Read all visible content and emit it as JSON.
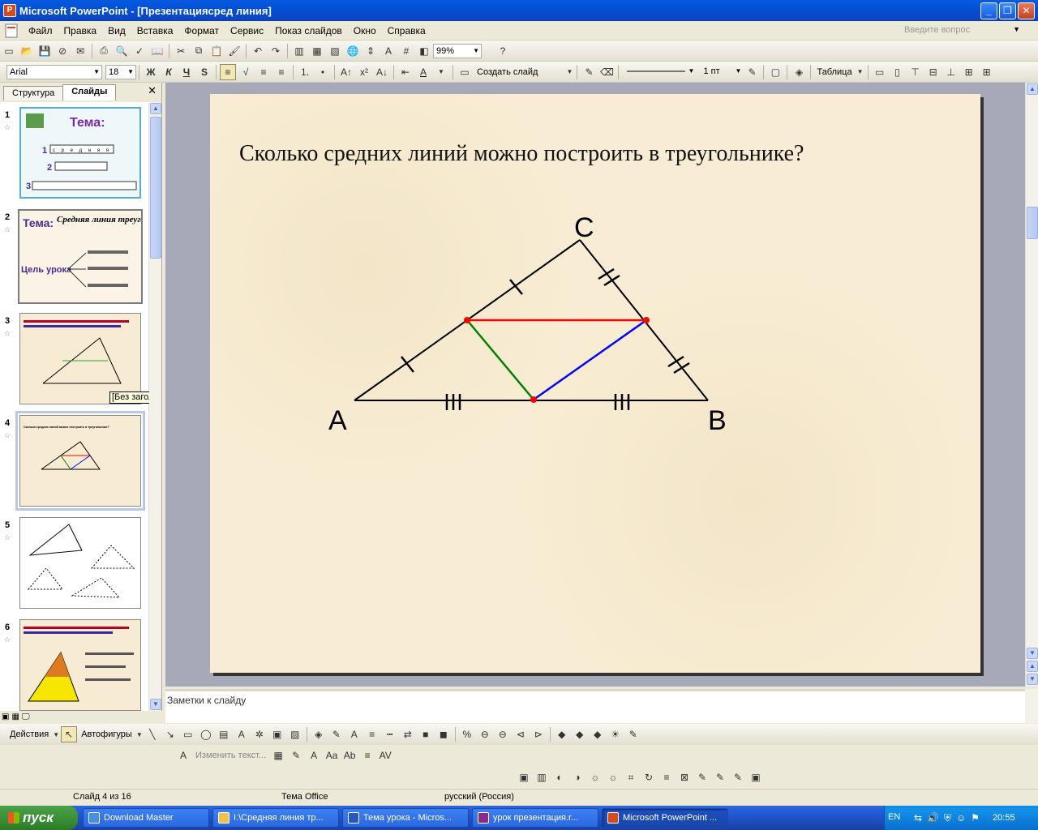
{
  "window": {
    "title": "Microsoft PowerPoint - [Презентациясред линия]",
    "controls": [
      "_",
      "❐",
      "✕"
    ]
  },
  "menu": {
    "items": [
      "Файл",
      "Правка",
      "Вид",
      "Вставка",
      "Формат",
      "Сервис",
      "Показ слайдов",
      "Окно",
      "Справка"
    ],
    "ask_placeholder": "Введите вопрос"
  },
  "toolbar_standard": {
    "zoom": "99%"
  },
  "toolbar_format": {
    "font": "Arial",
    "size": "18",
    "bold": "Ж",
    "italic": "К",
    "underline": "Ч",
    "shadow": "S",
    "new_slide": "Создать слайд",
    "line_weight": "1 пт",
    "table": "Таблица"
  },
  "left_panel": {
    "tabs": [
      "Структура",
      "Слайды"
    ],
    "close": "✕",
    "tooltip": "[Без заголовка]",
    "slides": [
      {
        "num": "1",
        "title": "Тема:",
        "rows": [
          "1",
          "2",
          "3"
        ],
        "letters": "с р е д н я я"
      },
      {
        "num": "2",
        "title": "Тема:",
        "subtitle": "Средняя линия треугольника",
        "goal": "Цель урока"
      },
      {
        "num": "3"
      },
      {
        "num": "4",
        "caption": "Сколько средних линий можно построить в треугольнике?"
      },
      {
        "num": "5"
      },
      {
        "num": "6"
      }
    ]
  },
  "slide": {
    "title": "Сколько средних линий можно построить в треугольнике?",
    "labels": {
      "a": "A",
      "b": "B",
      "c": "C"
    },
    "colors": {
      "red": "#ff0000",
      "green": "#008000",
      "blue": "#0000ff",
      "black": "#000000",
      "background": "#f8edd4"
    }
  },
  "notes": {
    "placeholder": "Заметки к слайду"
  },
  "draw_toolbar": {
    "actions": "Действия",
    "autoshapes": "Автофигуры",
    "edit_text": "Изменить текст..."
  },
  "statusbar": {
    "slide": "Слайд 4 из 16",
    "theme": "Тема Office",
    "language": "русский (Россия)"
  },
  "taskbar": {
    "start": "пуск",
    "tasks": [
      "Download Master",
      "I:\\Средняя линия тр...",
      "Тема урока - Micros...",
      "урок презентация.r...",
      "Microsoft PowerPoint ..."
    ],
    "lang": "EN",
    "clock": "20:55"
  }
}
